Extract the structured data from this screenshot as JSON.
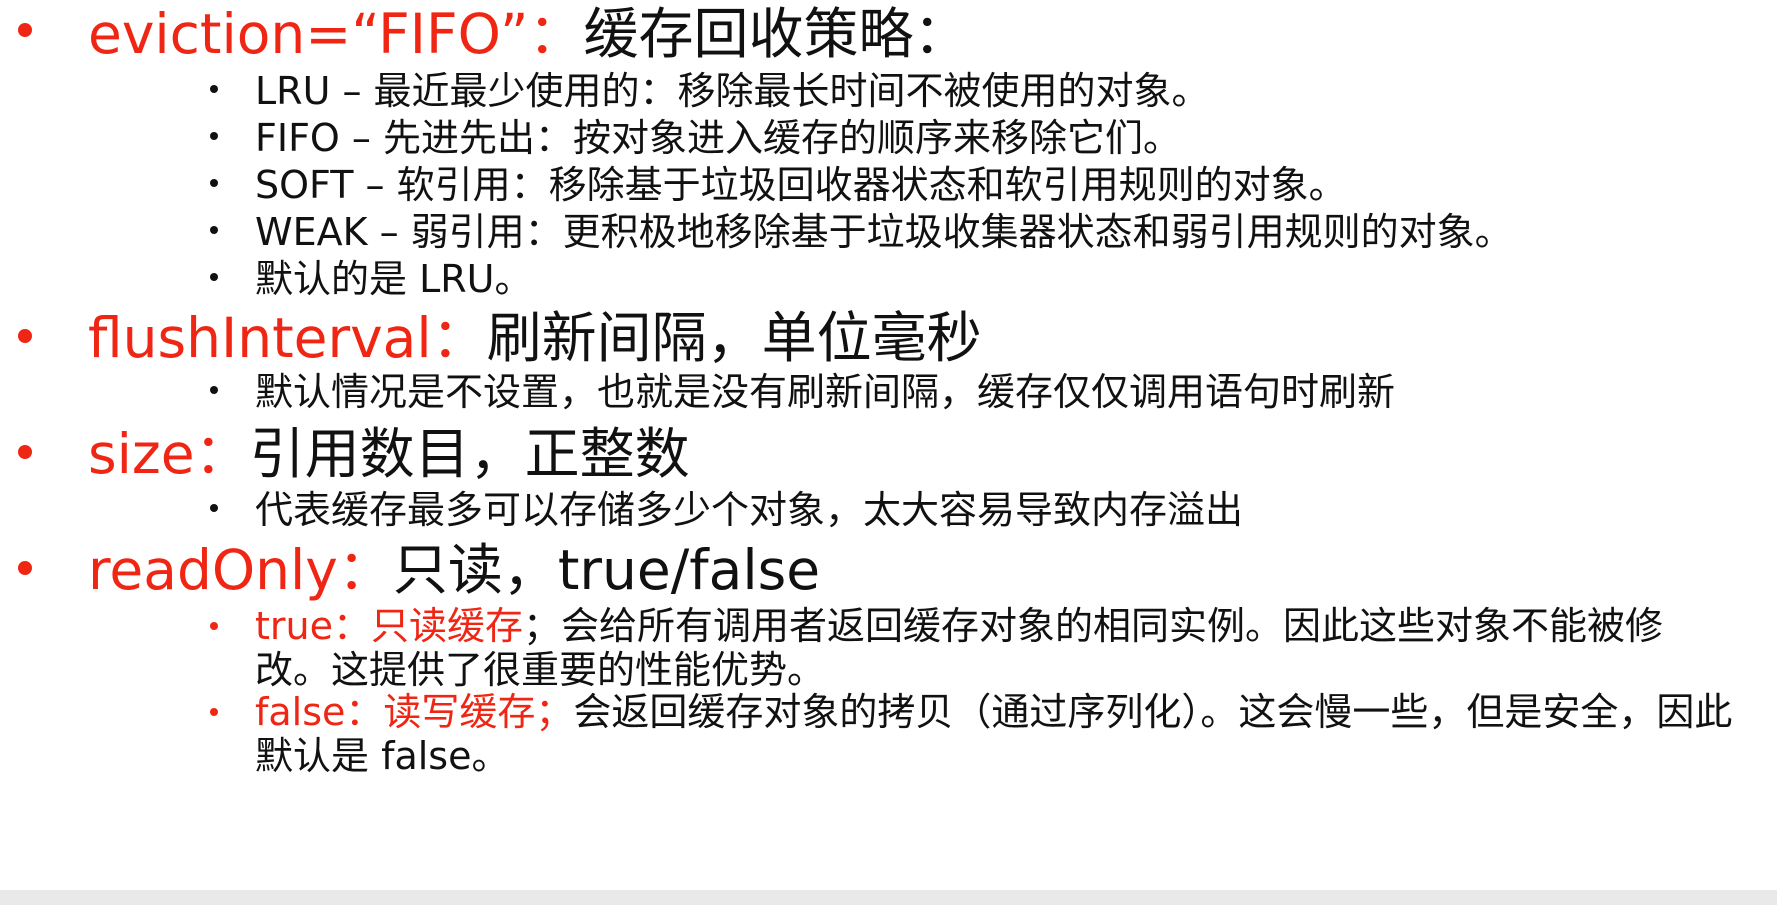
{
  "slide": {
    "items": [
      {
        "key": "eviction=“FIFO”",
        "separator": "：",
        "description": "缓存回收策略：",
        "subitems": [
          "LRU – 最近最少使用的：移除最长时间不被使用的对象。",
          "FIFO – 先进先出：按对象进入缓存的顺序来移除它们。",
          "SOFT – 软引用：移除基于垃圾回收器状态和软引用规则的对象。",
          "WEAK – 弱引用：更积极地移除基于垃圾收集器状态和弱引用规则的对象。",
          "默认的是 LRU。"
        ]
      },
      {
        "key": "flushInterval",
        "separator": "：",
        "description": "刷新间隔，单位毫秒",
        "subitems": [
          "默认情况是不设置，也就是没有刷新间隔，缓存仅仅调用语句时刷新"
        ]
      },
      {
        "key": "size",
        "separator": "：",
        "description": "引用数目，正整数",
        "subitems": [
          "代表缓存最多可以存储多少个对象，太大容易导致内存溢出"
        ]
      },
      {
        "key": "readOnly",
        "separator": "：",
        "description": "只读，true/false",
        "subitems": [
          {
            "highlight": "true：只读缓存",
            "text": "；会给所有调用者返回缓存对象的相同实例。因此这些对象不能被修改。这提供了很重要的性能优势。"
          },
          {
            "highlight": "false：读写缓存；",
            "text": "会返回缓存对象的拷贝（通过序列化）。这会慢一些，但是安全，因此默认是 false。"
          }
        ]
      }
    ]
  },
  "colors": {
    "accent": "#f02614",
    "text": "#111111",
    "background": "#ffffff"
  }
}
